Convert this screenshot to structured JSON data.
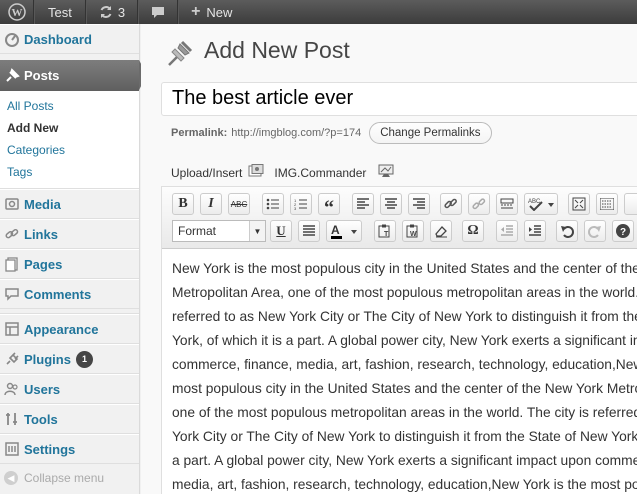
{
  "adminbar": {
    "site_name": "Test",
    "updates_count": "3",
    "new_label": "New"
  },
  "sidebar": {
    "dashboard": "Dashboard",
    "posts": "Posts",
    "posts_submenu": [
      "All Posts",
      "Add New",
      "Categories",
      "Tags"
    ],
    "media": "Media",
    "links": "Links",
    "pages": "Pages",
    "comments": "Comments",
    "appearance": "Appearance",
    "plugins": "Plugins",
    "plugins_badge": "1",
    "users": "Users",
    "tools": "Tools",
    "settings": "Settings",
    "collapse": "Collapse menu"
  },
  "main": {
    "page_title": "Add New Post",
    "post_title": "The best article ever",
    "permalink_label": "Permalink:",
    "permalink_url": "http://imgblog.com/?p=174",
    "change_permalinks": "Change Permalinks",
    "upload_insert": "Upload/Insert",
    "img_commander": "IMG.Commander",
    "format_select": "Format",
    "body_lines": [
      "New York is the most populous city in the United States and the center of the New York",
      "Metropolitan Area, one of the most populous metropolitan areas in the world. The city is",
      "referred to as New York City or The City of New York to distinguish it from the State of New",
      "York, of which it is a part. A global power city, New York exerts a significant impact upon",
      "commerce, finance, media, art, fashion, research, technology, education,New York is the",
      "most populous city in the United States and the center of the New York Metropolitan Area,",
      "one of the most populous metropolitan areas in the world. The city is referred to as New",
      "York City or The City of New York to distinguish it from the State of New York, of which it is",
      "a part. A global power city, New York exerts a significant impact upon commerce, finance,",
      "media, art, fashion, research, technology, education,New York is the most populous city"
    ]
  }
}
